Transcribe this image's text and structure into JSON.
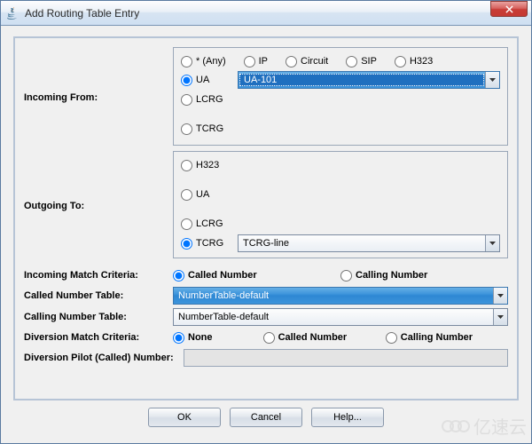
{
  "title": "Add Routing Table Entry",
  "incoming": {
    "label": "Incoming From:",
    "options": {
      "any": "* (Any)",
      "ip": "IP",
      "circuit": "Circuit",
      "sip": "SIP",
      "h323": "H323",
      "ua": "UA",
      "lcrg": "LCRG",
      "tcrg": "TCRG"
    },
    "selected": "ua",
    "ua_value": "UA-101"
  },
  "outgoing": {
    "label": "Outgoing To:",
    "options": {
      "h323": "H323",
      "ua": "UA",
      "lcrg": "LCRG",
      "tcrg": "TCRG"
    },
    "selected": "tcrg",
    "tcrg_value": "TCRG-line"
  },
  "incoming_match": {
    "label": "Incoming Match Criteria:",
    "called": "Called Number",
    "calling": "Calling Number",
    "selected": "called"
  },
  "called_table": {
    "label": "Called Number Table:",
    "value": "NumberTable-default"
  },
  "calling_table": {
    "label": "Calling Number Table:",
    "value": "NumberTable-default"
  },
  "diversion_match": {
    "label": "Diversion Match Criteria:",
    "none": "None",
    "called": "Called Number",
    "calling": "Calling Number",
    "selected": "none"
  },
  "diversion_pilot": {
    "label": "Diversion Pilot (Called) Number:",
    "value": ""
  },
  "buttons": {
    "ok": "OK",
    "cancel": "Cancel",
    "help": "Help..."
  },
  "watermark": "亿速云"
}
